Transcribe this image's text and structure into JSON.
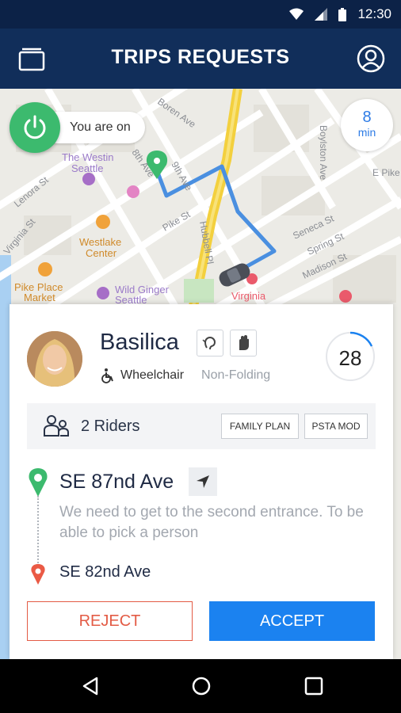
{
  "status_bar": {
    "time": "12:30",
    "icons": [
      "wifi-icon",
      "signal-icon",
      "battery-icon"
    ]
  },
  "app_bar": {
    "title": "TRIPS REQUESTS",
    "left_icon": "trips-icon",
    "right_icon": "profile-icon"
  },
  "map": {
    "online_toggle": {
      "label": "You are on",
      "icon": "power-icon",
      "color": "#3cba6e"
    },
    "eta": {
      "value": "8",
      "unit": "min"
    },
    "labels": {
      "borenave": "Boren Ave",
      "westin1": "The Westin",
      "westin2": "Seattle",
      "eighth": "8th Ave",
      "ninth": "9th Ave",
      "lenora": "Lenora St",
      "virginia_st": "Virginia St",
      "westlake1": "Westlake",
      "westlake2": "Center",
      "pike_st": "Pike St",
      "hubbell": "Hubbell Pl",
      "seneca": "Seneca St",
      "spring": "Spring St",
      "madison": "Madison St",
      "boylston": "Boylston Ave",
      "epike": "E Pike",
      "pike_place1": "Pike Place",
      "pike_place2": "Market",
      "wild_ginger1": "Wild Ginger",
      "wild_ginger2": "Seattle",
      "virginia_mason": "Virginia"
    }
  },
  "card": {
    "rider": {
      "name": "Basilica",
      "mobility": "Wheelchair",
      "folding": "Non-Folding",
      "score": "28"
    },
    "chips": [
      "ear-icon",
      "hand-icon"
    ],
    "riders_row": {
      "label": "2 Riders",
      "tags": [
        "FAMILY PLAN",
        "PSTA MOD"
      ]
    },
    "pickup": {
      "address": "SE 87nd Ave",
      "note": "We need to get to the second entrance. To be able to pick a person"
    },
    "dropoff": {
      "address": "SE 82nd Ave"
    },
    "actions": {
      "reject": "REJECT",
      "accept": "ACCEPT"
    }
  },
  "colors": {
    "primary": "#112e5a",
    "accent": "#1b82f0",
    "reject": "#e35b45",
    "online": "#3cba6e",
    "route": "#4a8fe0"
  },
  "nav_bar": {
    "items": [
      "back-icon",
      "home-icon",
      "recents-icon"
    ]
  }
}
